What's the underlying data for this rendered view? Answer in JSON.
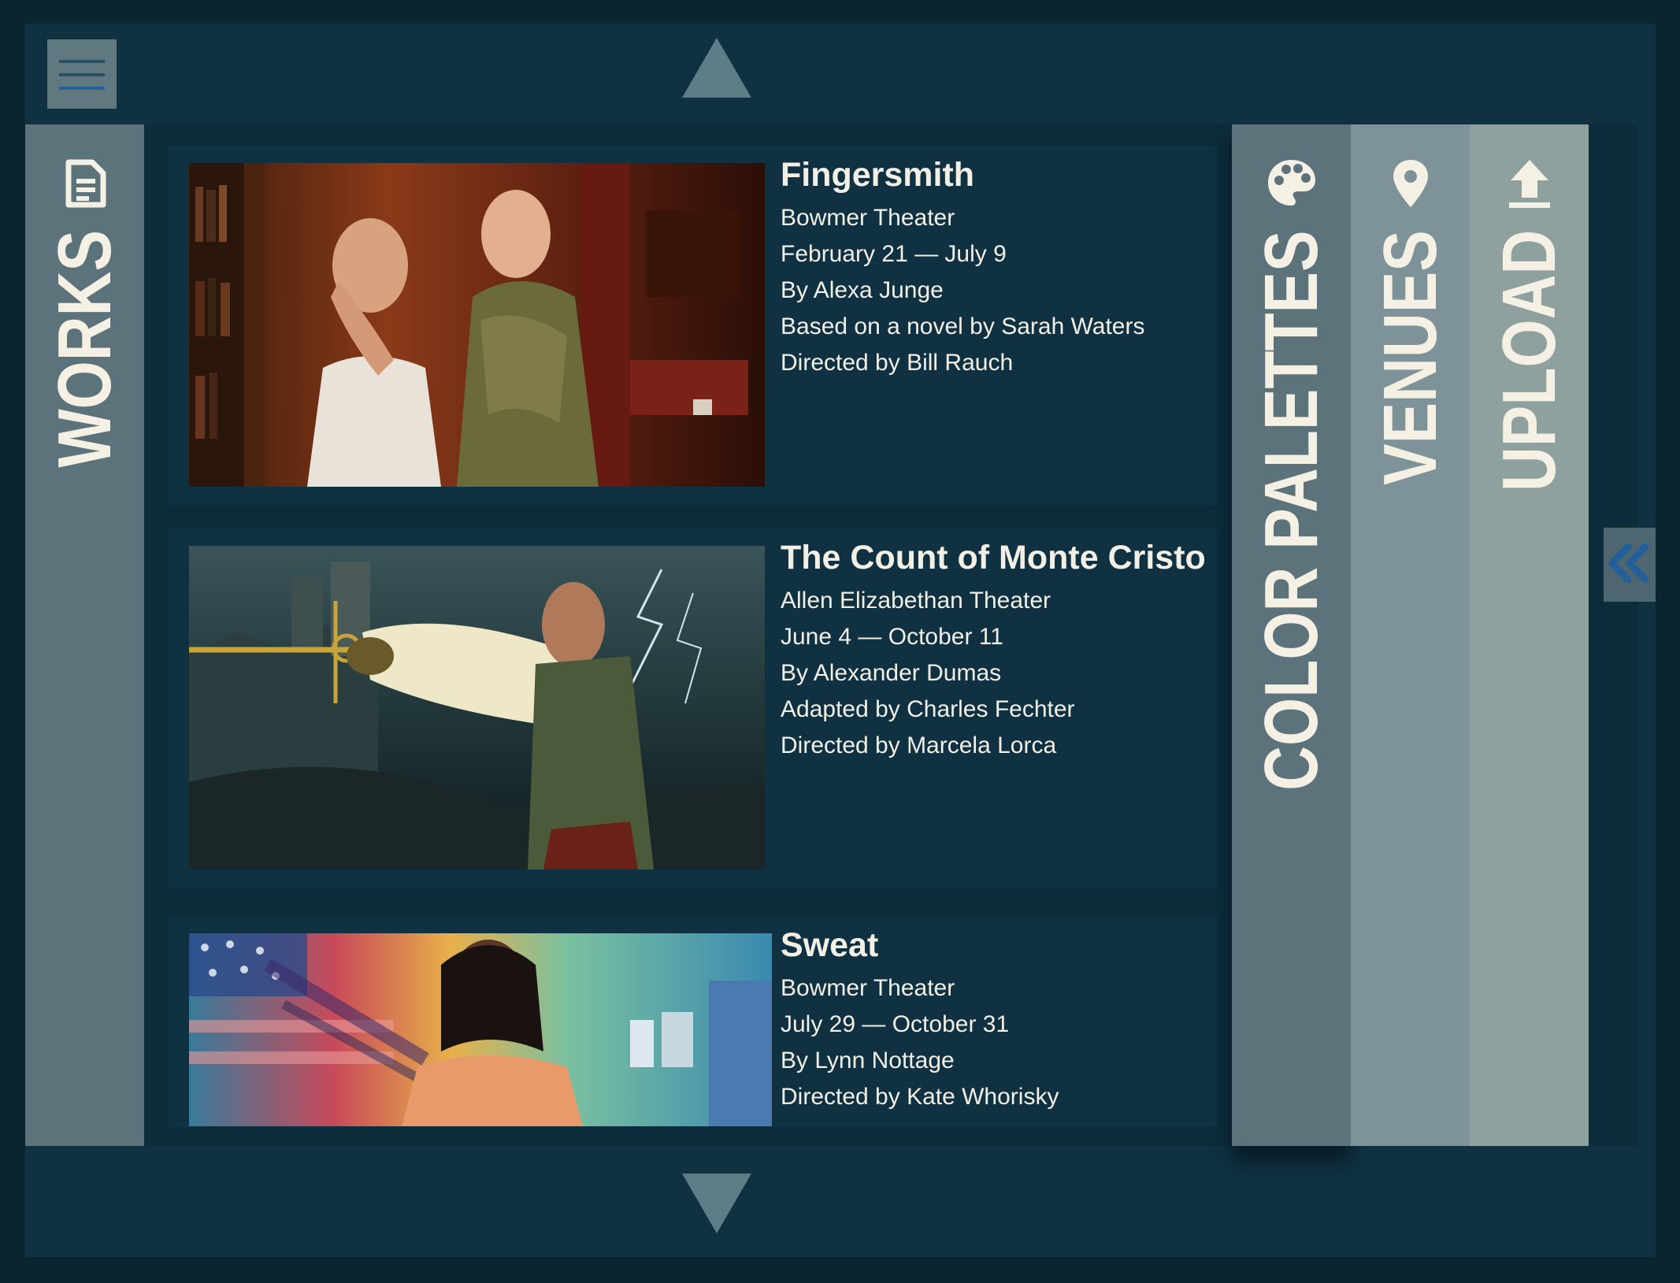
{
  "nav": {
    "menu_icon": "hamburger-icon",
    "scroll_up_icon": "triangle-up-icon",
    "scroll_down_icon": "triangle-down-icon",
    "collapse_icon": "double-chevron-left-icon"
  },
  "tabs": {
    "works": {
      "label": "WORKS",
      "icon": "document-icon"
    },
    "color_palettes": {
      "label": "COLOR PALETTES",
      "icon": "palette-icon"
    },
    "venues": {
      "label": "VENUES",
      "icon": "map-pin-icon"
    },
    "upload": {
      "label": "UPLOAD",
      "icon": "upload-icon"
    }
  },
  "works": [
    {
      "title": "Fingersmith",
      "lines": [
        "Bowmer Theater",
        "February 21 — July 9",
        "By Alexa Junge",
        "Based on a novel by Sarah Waters",
        "Directed by Bill Rauch"
      ]
    },
    {
      "title": "The Count of Monte Cristo",
      "lines": [
        "Allen Elizabethan Theater",
        "June 4 — October 11",
        "By Alexander Dumas",
        "Adapted by Charles Fechter",
        "Directed by Marcela Lorca"
      ]
    },
    {
      "title": "Sweat",
      "lines": [
        "Bowmer Theater",
        "July 29 — October 31",
        "By Lynn Nottage",
        "Directed by Kate Whorisky"
      ]
    }
  ],
  "colors": {
    "page_bg": "#0a2430",
    "frame_bg": "#0f3142",
    "tab_works": "#5c737b",
    "tab_palettes": "#5c737b",
    "tab_venues": "#7d9399",
    "tab_upload": "#8fa19f",
    "text_light": "#f2efe4",
    "accent_blue": "#235f9a"
  }
}
